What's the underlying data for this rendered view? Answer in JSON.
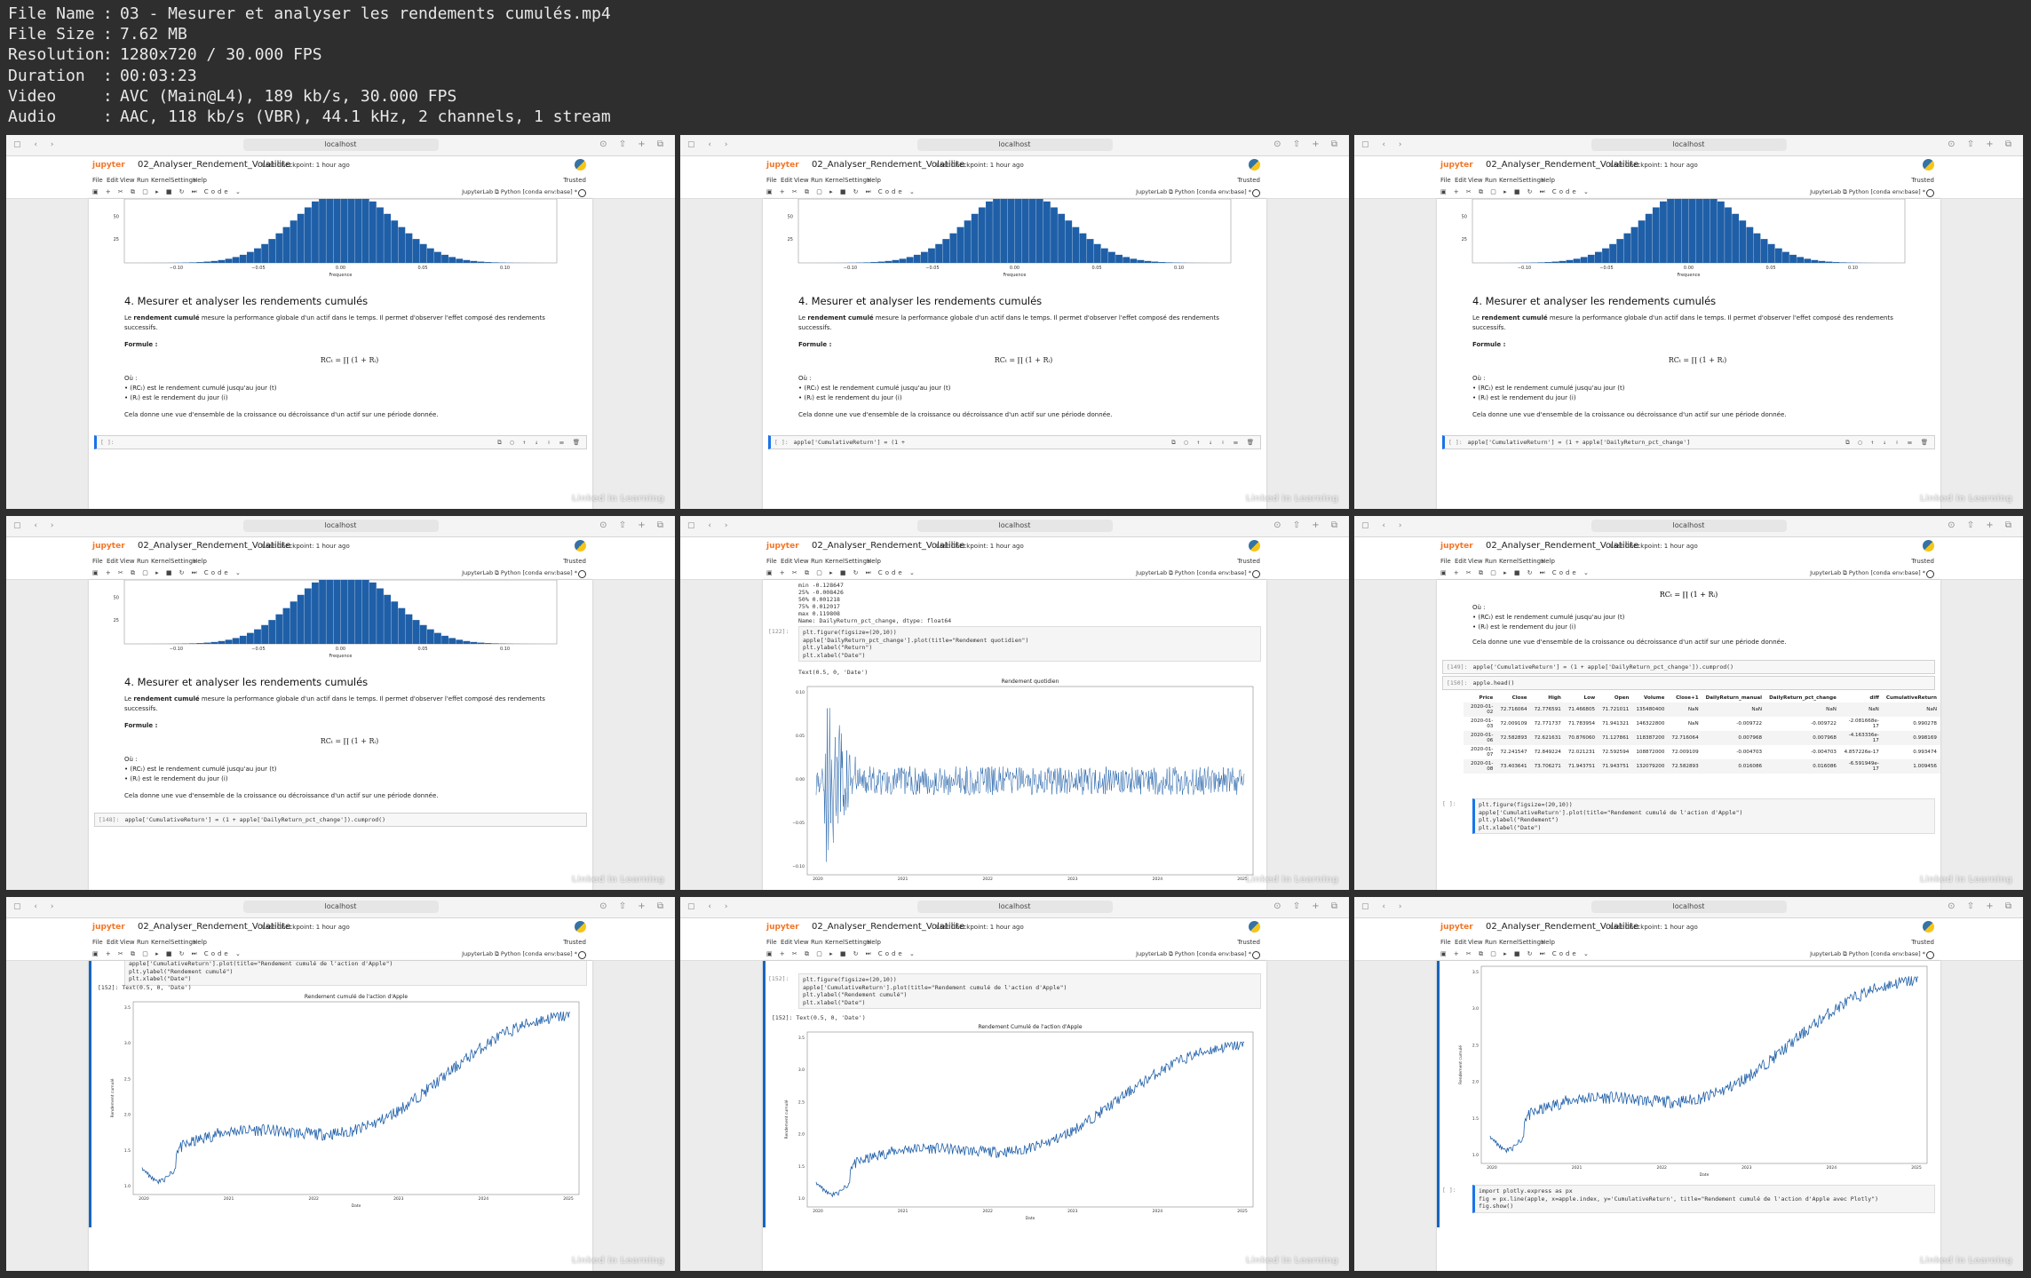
{
  "file_info": [
    {
      "key": "File Name",
      "value": "03 - Mesurer et analyser les rendements cumulés.mp4"
    },
    {
      "key": "File Size",
      "value": "7.62 MB"
    },
    {
      "key": "Resolution",
      "value": "1280x720 / 30.000 FPS"
    },
    {
      "key": "Duration",
      "value": "00:03:23"
    },
    {
      "key": "Video",
      "value": "AVC (Main@L4), 189 kb/s, 30.000 FPS"
    },
    {
      "key": "Audio",
      "value": "AAC, 118 kb/s (VBR), 44.1 kHz, 2 channels, 1 stream"
    }
  ],
  "common": {
    "url": "localhost",
    "logo": "jupyter",
    "notebook": "02_Analyser_Rendement_Volatilite",
    "checkpoint": "Last Checkpoint: 1 hour ago",
    "menu": [
      "File",
      "Edit",
      "View",
      "Run",
      "Kernel",
      "Settings",
      "Help"
    ],
    "trusted": "Trusted",
    "celltype": "Code",
    "jupyterlab": "JupyterLab",
    "kernel": "Python [conda env:base] *",
    "watermark": "Linked in Learning",
    "hist_xlabel": "Frequence",
    "hist_ticks": [
      "−0.10",
      "−0.05",
      "0.00",
      "0.05",
      "0.10"
    ],
    "hist_yticks": [
      "50",
      "25"
    ]
  },
  "markdown": {
    "heading": "4. Mesurer et analyser les rendements cumulés",
    "intro_bold": "rendement cumulé",
    "intro_pre": "Le ",
    "intro_post": " mesure la performance globale d'un actif dans le temps. Il permet d'observer l'effet composé des rendements successifs.",
    "formule": "Formule :",
    "formula": "RCₜ = ∏ (1 + Rᵢ)",
    "ou": "Où :",
    "b1": "(RCₜ) est le rendement cumulé jusqu'au jour (t)",
    "b2": "(Rᵢ) est le rendement du jour (i)",
    "conclusion": "Cela donne une vue d'ensemble de la croissance ou décroissance d'un actif sur une période donnée."
  },
  "frames": {
    "f2_code": "apple['CumulativeReturn'] = (1 + ",
    "f3_code": "apple['CumulativeReturn'] = (1 + apple['DailyReturn_pct_change']",
    "f4_code": "apple['CumulativeReturn'] = (1 + apple['DailyReturn_pct_change']).cumprod()",
    "f4_prompt": "[148]:",
    "f5_desc": [
      "min       -0.128647",
      "25%       -0.008426",
      "50%        0.001218",
      "75%        0.012017",
      "max        0.119808",
      "Name: DailyReturn_pct_change, dtype: float64"
    ],
    "f5_prompt": "[122]:",
    "f5_code": [
      "plt.figure(figsize=(20,10))",
      "apple['DailyReturn_pct_change'].plot(title=\"Rendement quotidien\")",
      "plt.ylabel(\"Return\")",
      "plt.xlabel(\"Date\")"
    ],
    "f5_out": "Text(0.5, 0, 'Date')",
    "f5_chart_title": "Rendement quotidien",
    "f6_code1": "apple['CumulativeReturn'] = (1 + apple['DailyReturn_pct_change']).cumprod()",
    "f6_code2": "apple.head()",
    "f6_p1": "[149]:",
    "f6_p2": "[150]:",
    "f6_cols": [
      "Price",
      "Close",
      "High",
      "Low",
      "Open",
      "Volume",
      "Close+1",
      "DailyReturn_manual",
      "DailyReturn_pct_change",
      "diff",
      "CumulativeReturn"
    ],
    "f6_rows": [
      [
        "2020-01-02",
        "72.716064",
        "72.776591",
        "71.466805",
        "71.721011",
        "135480400",
        "NaN",
        "NaN",
        "NaN",
        "NaN",
        "NaN"
      ],
      [
        "2020-01-03",
        "72.009109",
        "72.771737",
        "71.783954",
        "71.941321",
        "146322800",
        "NaN",
        "-0.009722",
        "-0.009722",
        "-2.081668e-17",
        "0.990278"
      ],
      [
        "2020-01-06",
        "72.582893",
        "72.621631",
        "70.876060",
        "71.127861",
        "118387200",
        "72.716064",
        "0.007968",
        "0.007968",
        "-4.163336e-17",
        "0.998169"
      ],
      [
        "2020-01-07",
        "72.241547",
        "72.849224",
        "72.021231",
        "72.592594",
        "108872000",
        "72.009109",
        "-0.004703",
        "-0.004703",
        "4.857226e-17",
        "0.993474"
      ],
      [
        "2020-01-08",
        "73.403641",
        "73.706271",
        "71.943751",
        "71.943751",
        "132079200",
        "72.582893",
        "0.016086",
        "0.016086",
        "-6.591949e-17",
        "1.009456"
      ]
    ],
    "f6_plot_code": [
      "plt.figure(figsize=(20,10))",
      "apple['CumulativeReturn'].plot(title=\"Rendement cumulé de l'action d'Apple\")",
      "plt.ylabel(\"Rendement\")",
      "plt.xlabel(\"Date\")"
    ],
    "f7_code": [
      "apple['CumulativeReturn'].plot(title=\"Rendement cumulé de l'action d'Apple\")",
      "plt.ylabel(\"Rendement cumulé\")",
      "plt.xlabel(\"Date\")"
    ],
    "f7_prompt": "[152]:",
    "f7_out": "Text(0.5, 0, 'Date')",
    "f7_chart_title": "Rendement cumulé de l'action d'Apple",
    "f7_ylabel": "Rendement cumulé",
    "f7_xlabel": "Date",
    "f8_code": [
      "plt.figure(figsize=(20,10))",
      "apple['CumulativeReturn'].plot(title=\"Rendement cumulé de l'action d'Apple\")",
      "plt.ylabel(\"Rendement cumulé\")",
      "plt.xlabel(\"Date\")"
    ],
    "f8_prompt": "[152]:",
    "f8_chart_title": "Rendement Cumulé de l'action d'Apple",
    "f9_code": [
      "import plotly.express as px",
      "fig = px.line(apple, x=apple.index, y='CumulativeReturn', title=\"Rendement cumulé de l'action d'Apple  avec Plotly\")",
      "fig.show()"
    ],
    "f9_prompt": "[ ]:",
    "empty_prompt": "[ ]:",
    "cum_yticks": [
      "1.0",
      "1.5",
      "2.0",
      "2.5",
      "3.0",
      "3.5"
    ],
    "cum_xticks": [
      "2020",
      "2021",
      "2022",
      "2023",
      "2024",
      "2025"
    ],
    "daily_yticks": [
      "0.10",
      "0.05",
      "0.00",
      "−0.05",
      "−0.10"
    ]
  }
}
